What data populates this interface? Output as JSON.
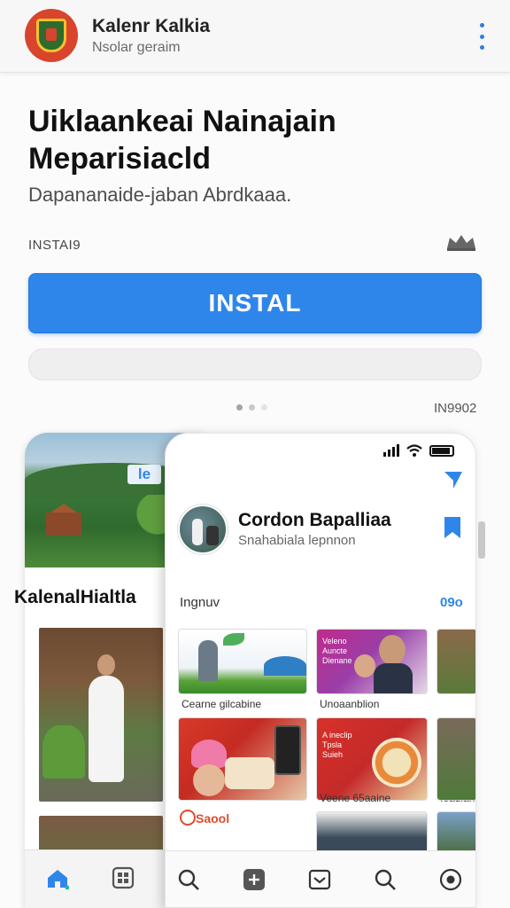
{
  "header": {
    "app_name": "Kalenr Kalkia",
    "app_subtitle": "Nsolar geraim"
  },
  "hero": {
    "title": "Uiklaankeai Nainajain Meparisiacld",
    "subtitle": "Dapananaide-jaban Abrdkaaa.",
    "install_small": "INSTAI9"
  },
  "install_button": {
    "label": "INSTAL"
  },
  "carousel": {
    "page_count": "IN9902"
  },
  "back_screen": {
    "badge": "le",
    "title": "KalenalHialtla"
  },
  "front_screen": {
    "profile_name": "Cordon Bapalliaa",
    "profile_sub": "Snahabiala lepnnon",
    "section_label": "Ingnuv",
    "section_count": "09o",
    "tiles": [
      {
        "caption": "Cearne gilcabine"
      },
      {
        "caption": "Unoaanblion"
      },
      {
        "caption": ""
      },
      {
        "caption": ""
      },
      {
        "caption": "Veene 65aaine"
      },
      {
        "caption": "Ieadian"
      },
      {
        "caption": "Saool"
      },
      {
        "caption": ""
      },
      {
        "caption": ""
      }
    ],
    "tile2_text": [
      "Veleno",
      "Auncte",
      "Dienane"
    ],
    "tile5_text": [
      "A ineclip",
      "Tpsla",
      "Suieh"
    ]
  },
  "colors": {
    "accent": "#2f86ea",
    "brand": "#d9442c"
  },
  "icons": {
    "menu": "kebab-icon",
    "crown": "crown-icon",
    "share": "share-icon",
    "bookmark": "bookmark-icon",
    "home": "home-icon",
    "grid": "grid-icon",
    "search": "search-icon",
    "add": "add-icon",
    "inbox": "inbox-icon",
    "profile": "profile-icon"
  }
}
